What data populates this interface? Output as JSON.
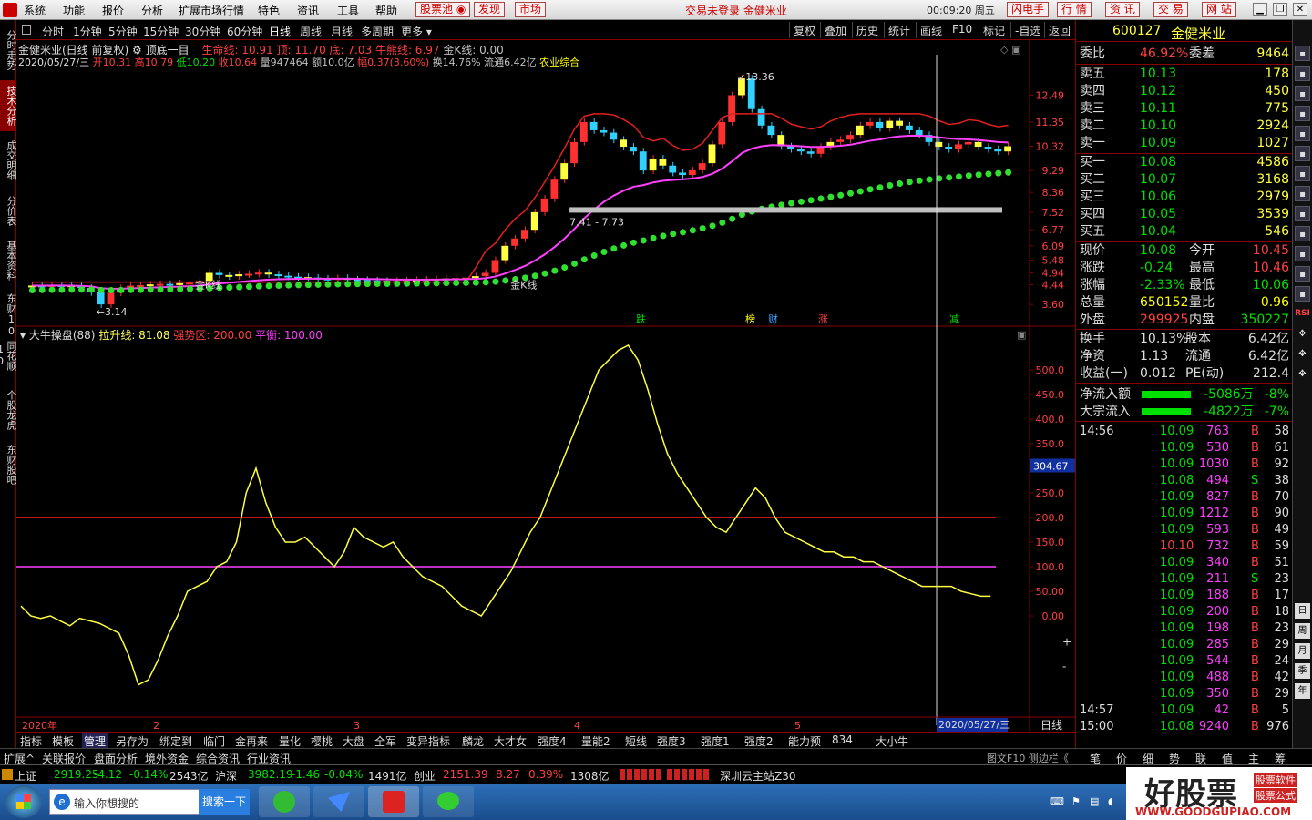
{
  "menu": {
    "items": [
      "系统",
      "功能",
      "报价",
      "分析",
      "扩展市场行情",
      "特色",
      "资讯",
      "工具",
      "帮助"
    ],
    "stockpool": "股票池",
    "discover": "发现",
    "market": "市场",
    "notice": "交易未登录  金健米业",
    "clock": "00:09:20 周五",
    "quick": [
      "闪电手",
      "行 情",
      "资 讯",
      "交 易",
      "网 站"
    ]
  },
  "lefttabs": [
    "分时走势",
    "技术分析",
    "成交明细",
    "分价表",
    "基本资料",
    "东财10",
    "同花顺10",
    "个股龙虎",
    "东财股吧"
  ],
  "periods": [
    "分时",
    "1分钟",
    "5分钟",
    "15分钟",
    "30分钟",
    "60分钟",
    "日线",
    "周线",
    "月线",
    "多周期",
    "更多"
  ],
  "toolbar": [
    "复权",
    "叠加",
    "历史",
    "统计",
    "画线",
    "F10",
    "标记",
    "-自选",
    "返回"
  ],
  "main": {
    "name": "金健米业(日线 前复权)",
    "indicator": "顶底一目",
    "lines": [
      {
        "label": "生命线: 10.91",
        "color": "#ff4040"
      },
      {
        "label": "顶: 11.70",
        "color": "#ff4040"
      },
      {
        "label": "底: 7.03",
        "color": "#ff4040"
      },
      {
        "label": "牛熊线: 6.97",
        "color": "#ff4040"
      },
      {
        "label": "金K线: 0.00",
        "color": "#c0c0c0"
      }
    ],
    "date": "2020/05/27/三",
    "ohlc": [
      {
        "t": "开10.31",
        "c": "#ff4040"
      },
      {
        "t": "高10.79",
        "c": "#ff4040"
      },
      {
        "t": "低10.20",
        "c": "#00e000"
      },
      {
        "t": "收10.64",
        "c": "#ff4040"
      },
      {
        "t": "量947464",
        "c": "#c0c0c0"
      },
      {
        "t": "额10.0亿",
        "c": "#c0c0c0"
      },
      {
        "t": "幅0.37(3.60%)",
        "c": "#ff4040"
      },
      {
        "t": "换14.76%",
        "c": "#c0c0c0"
      },
      {
        "t": "流通6.42亿",
        "c": "#c0c0c0"
      },
      {
        "t": "农业综合",
        "c": "#ffff00"
      }
    ],
    "yticks": [
      "12.49",
      "11.35",
      "10.32",
      "9.29",
      "8.36",
      "7.52",
      "6.77",
      "6.09",
      "5.48",
      "4.94",
      "4.44",
      "3.60"
    ],
    "annotations": {
      "high": "13.36",
      "low": "3.14",
      "band": "7.41 - 7.73",
      "jinK1": "金K线",
      "jinK2": "金K线"
    },
    "events": [
      {
        "t": "跌",
        "c": "#00e000"
      },
      {
        "t": "榜",
        "c": "#ffff00"
      },
      {
        "t": "财",
        "c": "#40a0ff"
      },
      {
        "t": "涨",
        "c": "#ff4040"
      },
      {
        "t": "减",
        "c": "#00e000"
      }
    ]
  },
  "sub": {
    "name": "大牛操盘(88)",
    "lift": "拉升线: 81.08",
    "strong": "强势区: 200.00",
    "balance": "平衡: 100.00",
    "yticks": [
      "500.0",
      "450.0",
      "400.0",
      "350.0",
      "300.0",
      "250.0",
      "200.0",
      "150.0",
      "100.0",
      "50.00",
      "0.00"
    ],
    "cursor_value": "304.67",
    "plusminus": [
      "+",
      "-"
    ]
  },
  "xaxis": {
    "labels": [
      "2020年",
      "2",
      "3",
      "4",
      "5"
    ],
    "cursor_date": "2020/05/27/三",
    "period": "日线"
  },
  "bottomtabs": [
    "指标",
    "模板",
    "管理",
    "另存为",
    "绑定到",
    "临门",
    "金再来",
    "量化",
    "樱桃",
    "大盘",
    "全军",
    "变异指标",
    "麟龙",
    "大才女",
    "强度4",
    "量能2",
    "短线",
    "强度3",
    "强度1",
    "强度2",
    "能力预",
    "834",
    "大小牛"
  ],
  "row2": [
    "扩展^",
    "关联报价",
    "盘面分析",
    "境外资金",
    "综合资讯",
    "行业资讯"
  ],
  "row2right": "图文F10  侧边栏《",
  "quote": {
    "code": "600127",
    "name": "金健米业",
    "weibi": {
      "label": "委比",
      "val": "46.92%",
      "label2": "委差",
      "val2": "9464"
    },
    "sell": [
      {
        "l": "卖五",
        "p": "10.13",
        "v": "178"
      },
      {
        "l": "卖四",
        "p": "10.12",
        "v": "450"
      },
      {
        "l": "卖三",
        "p": "10.11",
        "v": "775"
      },
      {
        "l": "卖二",
        "p": "10.10",
        "v": "2924"
      },
      {
        "l": "卖一",
        "p": "10.09",
        "v": "1027"
      }
    ],
    "buy": [
      {
        "l": "买一",
        "p": "10.08",
        "v": "4586"
      },
      {
        "l": "买二",
        "p": "10.07",
        "v": "3168"
      },
      {
        "l": "买三",
        "p": "10.06",
        "v": "2979"
      },
      {
        "l": "买四",
        "p": "10.05",
        "v": "3539"
      },
      {
        "l": "买五",
        "p": "10.04",
        "v": "546"
      }
    ],
    "stats": [
      {
        "a": "现价",
        "av": "10.08",
        "ac": "#00e000",
        "b": "今开",
        "bv": "10.45",
        "bc": "#ff4040"
      },
      {
        "a": "涨跌",
        "av": "-0.24",
        "ac": "#00e000",
        "b": "最高",
        "bv": "10.46",
        "bc": "#ff4040"
      },
      {
        "a": "涨幅",
        "av": "-2.33%",
        "ac": "#00e000",
        "b": "最低",
        "bv": "10.06",
        "bc": "#00e000"
      },
      {
        "a": "总量",
        "av": "650152",
        "ac": "#ffff00",
        "b": "量比",
        "bv": "0.96",
        "bc": "#ffff00"
      },
      {
        "a": "外盘",
        "av": "299925",
        "ac": "#ff4040",
        "b": "内盘",
        "bv": "350227",
        "bc": "#00e000"
      }
    ],
    "fund": [
      {
        "a": "换手",
        "av": "10.13%",
        "b": "股本",
        "bv": "6.42亿"
      },
      {
        "a": "净资",
        "av": "1.13",
        "b": "流通",
        "bv": "6.42亿"
      },
      {
        "a": "收益(一)",
        "av": "0.012",
        "b": "PE(动)",
        "bv": "212.4"
      }
    ],
    "flows": [
      {
        "l": "净流入额",
        "v": "-5086万",
        "p": "-8%"
      },
      {
        "l": "大宗流入",
        "v": "-4822万",
        "p": "-7%"
      }
    ],
    "ticks": [
      {
        "t": "14:56",
        "p": "10.09",
        "v": "763",
        "bs": "B",
        "n": "58"
      },
      {
        "t": "",
        "p": "10.09",
        "v": "530",
        "bs": "B",
        "n": "61"
      },
      {
        "t": "",
        "p": "10.09",
        "v": "1030",
        "bs": "B",
        "n": "92"
      },
      {
        "t": "",
        "p": "10.08",
        "v": "494",
        "bs": "S",
        "n": "38"
      },
      {
        "t": "",
        "p": "10.09",
        "v": "827",
        "bs": "B",
        "n": "70"
      },
      {
        "t": "",
        "p": "10.09",
        "v": "1212",
        "bs": "B",
        "n": "90"
      },
      {
        "t": "",
        "p": "10.09",
        "v": "593",
        "bs": "B",
        "n": "49"
      },
      {
        "t": "",
        "p": "10.10",
        "v": "732",
        "bs": "B",
        "n": "59"
      },
      {
        "t": "",
        "p": "10.09",
        "v": "340",
        "bs": "B",
        "n": "51"
      },
      {
        "t": "",
        "p": "10.09",
        "v": "211",
        "bs": "S",
        "n": "23"
      },
      {
        "t": "",
        "p": "10.09",
        "v": "188",
        "bs": "B",
        "n": "17"
      },
      {
        "t": "",
        "p": "10.09",
        "v": "200",
        "bs": "B",
        "n": "18"
      },
      {
        "t": "",
        "p": "10.09",
        "v": "198",
        "bs": "B",
        "n": "23"
      },
      {
        "t": "",
        "p": "10.09",
        "v": "285",
        "bs": "B",
        "n": "29"
      },
      {
        "t": "",
        "p": "10.09",
        "v": "544",
        "bs": "B",
        "n": "24"
      },
      {
        "t": "",
        "p": "10.09",
        "v": "488",
        "bs": "B",
        "n": "42"
      },
      {
        "t": "",
        "p": "10.09",
        "v": "350",
        "bs": "B",
        "n": "29"
      },
      {
        "t": "14:57",
        "p": "10.09",
        "v": "42",
        "bs": "B",
        "n": "5"
      },
      {
        "t": "15:00",
        "p": "10.08",
        "v": "9240",
        "bs": "B",
        "n": "976"
      }
    ]
  },
  "rbottom": [
    "笔",
    "价",
    "细",
    "势",
    "联",
    "值",
    "主",
    "筹"
  ],
  "status": [
    {
      "t": "上证",
      "c": "#ddd"
    },
    {
      "t": "2919.25",
      "c": "#00e000"
    },
    {
      "t": "-4.12",
      "c": "#00e000"
    },
    {
      "t": "-0.14%",
      "c": "#00e000"
    },
    {
      "t": "2543亿",
      "c": "#ddd"
    },
    {
      "t": "沪深",
      "c": "#ddd"
    },
    {
      "t": "3982.19",
      "c": "#00e000"
    },
    {
      "t": "-1.46",
      "c": "#00e000"
    },
    {
      "t": "-0.04%",
      "c": "#00e000"
    },
    {
      "t": "1491亿",
      "c": "#ddd"
    },
    {
      "t": "创业",
      "c": "#ddd"
    },
    {
      "t": "2151.39",
      "c": "#ff4040"
    },
    {
      "t": "8.27",
      "c": "#ff4040"
    },
    {
      "t": "0.39%",
      "c": "#ff4040"
    },
    {
      "t": "1308亿",
      "c": "#ddd"
    },
    {
      "t": "深圳云主站Z30",
      "c": "#ddd"
    }
  ],
  "taskbar": {
    "search_placeholder": "输入你想搜的",
    "search_btn": "搜索一下"
  },
  "watermark": {
    "big": "好股票",
    "small1": "股票软件",
    "small2": "股票公式",
    "url": "WWW.GOODGUPIAO.COM"
  },
  "righticons": [
    "RSI"
  ],
  "chart_data": [
    {
      "type": "candlestick",
      "title": "金健米业(日线 前复权)",
      "ylim": [
        3.14,
        13.36
      ],
      "series": [
        {
          "name": "生命线",
          "value": 10.91
        },
        {
          "name": "顶",
          "value": 11.7
        },
        {
          "name": "底",
          "value": 7.03
        },
        {
          "name": "牛熊线",
          "value": 6.97
        }
      ],
      "close": [
        4.4,
        4.39,
        4.42,
        4.41,
        4.38,
        4.3,
        4.12,
        3.6,
        4.1,
        4.3,
        4.4,
        4.42,
        4.45,
        4.47,
        4.46,
        4.5,
        4.52,
        4.6,
        4.94,
        4.85,
        4.8,
        4.88,
        4.9,
        4.95,
        4.88,
        4.82,
        4.78,
        4.76,
        4.74,
        4.7,
        4.68,
        4.72,
        4.66,
        4.64,
        4.62,
        4.6,
        4.58,
        4.6,
        4.62,
        4.64,
        4.66,
        4.68,
        4.7,
        4.72,
        4.74,
        4.8,
        4.94,
        5.48,
        6.09,
        6.4,
        6.77,
        7.52,
        8.1,
        8.9,
        9.6,
        10.5,
        11.35,
        11.0,
        10.9,
        10.6,
        10.3,
        10.1,
        9.29,
        9.8,
        9.5,
        9.2,
        9.1,
        9.3,
        9.6,
        10.4,
        11.35,
        12.49,
        13.2,
        11.9,
        11.2,
        10.8,
        10.32,
        10.2,
        10.1,
        10.0,
        10.3,
        10.5,
        10.6,
        10.8,
        11.2,
        11.35,
        11.1,
        11.4,
        11.2,
        11.0,
        10.8,
        10.5,
        10.3,
        10.2,
        10.4,
        10.5,
        10.3,
        10.2,
        10.1,
        10.32
      ],
      "dates": "2020-01 .. 2020-05-27"
    },
    {
      "type": "line",
      "title": "大牛操盘(88)",
      "ylim": [
        -200,
        550
      ],
      "series": [
        {
          "name": "拉升线",
          "value_last": 81.08
        }
      ],
      "hlines": [
        {
          "name": "强势区",
          "value": 200
        },
        {
          "name": "平衡",
          "value": 100
        }
      ],
      "values": [
        20,
        0,
        -5,
        0,
        -10,
        -20,
        -5,
        -10,
        -15,
        -25,
        -35,
        -80,
        -140,
        -130,
        -90,
        -40,
        0,
        50,
        60,
        70,
        100,
        110,
        150,
        250,
        300,
        230,
        180,
        150,
        150,
        160,
        140,
        120,
        100,
        130,
        180,
        160,
        150,
        140,
        150,
        120,
        100,
        80,
        70,
        60,
        40,
        20,
        10,
        0,
        30,
        60,
        90,
        130,
        170,
        200,
        250,
        300,
        350,
        400,
        450,
        500,
        520,
        540,
        550,
        520,
        460,
        390,
        330,
        290,
        260,
        230,
        200,
        180,
        170,
        200,
        230,
        260,
        240,
        200,
        170,
        160,
        150,
        140,
        130,
        130,
        120,
        120,
        110,
        110,
        100,
        90,
        80,
        70,
        60,
        60,
        60,
        60,
        50,
        45,
        40,
        40
      ]
    }
  ]
}
